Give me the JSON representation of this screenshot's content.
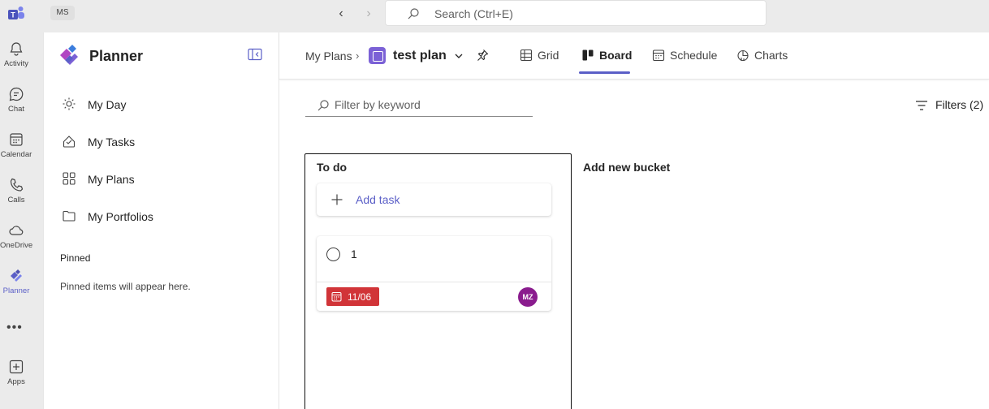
{
  "titlebar": {
    "account_badge": "MS",
    "search_placeholder": "Search (Ctrl+E)",
    "back_glyph": "‹",
    "forward_glyph": "›"
  },
  "rail": {
    "items": [
      {
        "label": "Activity",
        "icon": "bell-icon"
      },
      {
        "label": "Chat",
        "icon": "chat-icon"
      },
      {
        "label": "Calendar",
        "icon": "calendar-icon"
      },
      {
        "label": "Calls",
        "icon": "phone-icon"
      },
      {
        "label": "OneDrive",
        "icon": "cloud-icon"
      },
      {
        "label": "Planner",
        "icon": "planner-icon",
        "active": true
      },
      {
        "label": "Apps",
        "icon": "add-apps-icon"
      }
    ],
    "more": "•••"
  },
  "sidebar": {
    "app_name": "Planner",
    "items": [
      {
        "label": "My Day",
        "icon": "sun-icon"
      },
      {
        "label": "My Tasks",
        "icon": "tasks-icon"
      },
      {
        "label": "My Plans",
        "icon": "grid-icon"
      },
      {
        "label": "My Portfolios",
        "icon": "folder-icon"
      }
    ],
    "pinned_header": "Pinned",
    "pinned_empty": "Pinned items will appear here."
  },
  "header": {
    "breadcrumb": "My Plans",
    "separator": "›",
    "plan_name": "test plan",
    "tabs": [
      {
        "label": "Grid",
        "icon": "grid-view-icon"
      },
      {
        "label": "Board",
        "icon": "board-view-icon",
        "active": true
      },
      {
        "label": "Schedule",
        "icon": "schedule-view-icon"
      },
      {
        "label": "Charts",
        "icon": "charts-view-icon"
      }
    ]
  },
  "toolbar": {
    "filter_placeholder": "Filter by keyword",
    "filters_label": "Filters (2)"
  },
  "board": {
    "bucket_name": "To do",
    "add_task_label": "Add task",
    "task": {
      "title": "1",
      "due": "11/06",
      "assignee_initials": "MZ"
    },
    "add_bucket_label": "Add new bucket"
  },
  "colors": {
    "accent": "#5b5fc7",
    "due_badge": "#d13438",
    "avatar": "#8a1c8e",
    "plan_icon": "#7b61d6"
  }
}
